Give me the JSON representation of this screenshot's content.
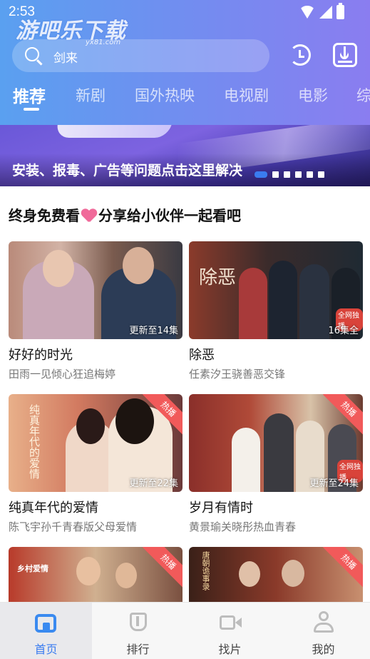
{
  "status_bar": {
    "time": "2:53"
  },
  "watermark": {
    "text": "游吧乐下载",
    "sub": "yx81.com"
  },
  "header": {
    "search_text": "剑来",
    "tabs": [
      {
        "label": "推荐",
        "active": true
      },
      {
        "label": "新剧"
      },
      {
        "label": "国外热映"
      },
      {
        "label": "电视剧"
      },
      {
        "label": "电影"
      },
      {
        "label": "综"
      }
    ]
  },
  "banner": {
    "text": "安装、报毒、广告等问题点击这里解决",
    "page_count": 6,
    "active_index": 0
  },
  "section": {
    "title_left": "终身免费看",
    "title_right": "分享给小伙伴一起看吧"
  },
  "cards": [
    {
      "title": "好好的时光",
      "subtitle": "田雨一见倾心狂追梅婷",
      "badge": "更新至14集",
      "hot": false
    },
    {
      "title": "除恶",
      "subtitle": "任素汐王骁善恶交锋",
      "badge": "16集全",
      "hot": false,
      "overlay": "除恶",
      "tag": "全网独播"
    },
    {
      "title": "纯真年代的爱情",
      "subtitle": "陈飞宇孙千青春版父母爱情",
      "badge": "更新至22集",
      "hot": true,
      "overlay": "纯真年代的爱情"
    },
    {
      "title": "岁月有情时",
      "subtitle": "黄景瑜关晓彤热血青春",
      "badge": "更新至24集",
      "hot": true,
      "tag": "全网独播"
    },
    {
      "title": "",
      "subtitle": "",
      "badge": "",
      "hot": true,
      "overlay": "乡村爱情"
    },
    {
      "title": "",
      "subtitle": "",
      "badge": "",
      "hot": true,
      "overlay": "唐朝诡事录"
    }
  ],
  "hot_label": "热播",
  "bottom_nav": [
    {
      "label": "首页",
      "icon": "home-icon",
      "active": true
    },
    {
      "label": "排行",
      "icon": "rank-icon"
    },
    {
      "label": "找片",
      "icon": "film-icon"
    },
    {
      "label": "我的",
      "icon": "profile-icon"
    }
  ],
  "colors": {
    "accent": "#3a7cf0",
    "header_start": "#5aa0f0",
    "header_end": "#8a7df0",
    "hot": "#f15a5a"
  }
}
